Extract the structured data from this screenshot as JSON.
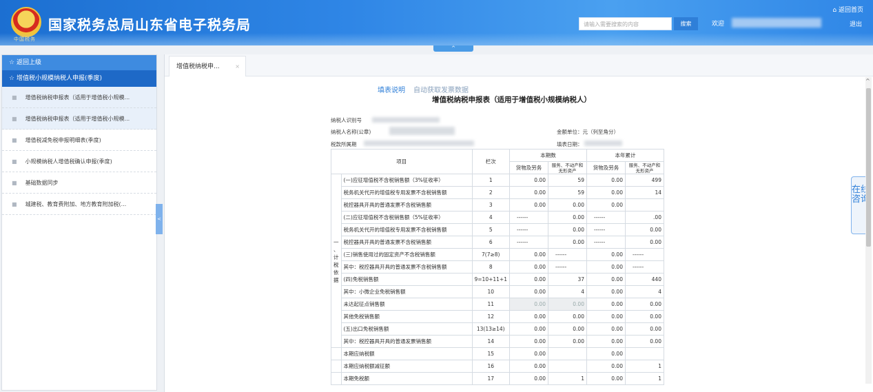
{
  "header": {
    "title": "国家税务总局山东省电子税务局",
    "emblem_text": "中国税务",
    "search_placeholder": "请输入需要搜索的内容",
    "search_button": "搜索",
    "welcome": "欢迎",
    "home": "返回首页",
    "logout": "退出",
    "collapse": "^"
  },
  "sidebar": {
    "back": "返回上级",
    "group": "增值税小规模纳税人申报(季度)",
    "items": [
      {
        "label": "增值税纳税申报表（适用于增值税小规模..."
      },
      {
        "label": "增值税纳税申报表（适用于增值税小规模..."
      },
      {
        "label": "增值税减免税申报明细表(季度)"
      },
      {
        "label": "小规模纳税人增值税确认申报(季度)"
      },
      {
        "label": "基础数据同步"
      },
      {
        "label": "城建税、教育费附加、地方教育附加税(..."
      }
    ],
    "toggle": "<"
  },
  "tabs": [
    {
      "label": "增值税纳税申...",
      "close": "×"
    }
  ],
  "report": {
    "link_fill": "填表说明",
    "link_auto": "自动获取发票数据",
    "title": "增值税纳税申报表（适用于增值税小规模纳税人）",
    "taxpayer_id_label": "纳税人识别号",
    "taxpayer_name_label": "纳税人名称(公章)",
    "period_label": "税款所属期",
    "unit_label": "金额单位：元（列至角分）",
    "fill_date_label": "填表日期：",
    "col_item": "项目",
    "col_line": "栏次",
    "col_current": "本期数",
    "col_ytd": "本年累计",
    "col_goods": "货物及劳务",
    "col_services": "服务、不动产和无形资产",
    "side_label": "一、计税依据",
    "rows": [
      {
        "item": "(一)应征增值税不含税销售额（3%征收率）",
        "line": "1",
        "c1": "0.00",
        "c2": "59",
        "c3": "0.00",
        "c4": "499"
      },
      {
        "item": "税务机关代开的增值税专用发票不含税销售额",
        "line": "2",
        "c1": "0.00",
        "c2": "59",
        "c3": "0.00",
        "c4": "14"
      },
      {
        "item": "税控器具开具的普通发票不含税销售额",
        "line": "3",
        "c1": "0.00",
        "c2": "0.00",
        "c3": "0.00",
        "c4": ""
      },
      {
        "item": "(二)应征增值税不含税销售额（5%征收率）",
        "line": "4",
        "c1": "------",
        "c2": "0.00",
        "c3": "------",
        "c4": ".00"
      },
      {
        "item": "税务机关代开的增值税专用发票不含税销售额",
        "line": "5",
        "c1": "------",
        "c2": "0.00",
        "c3": "------",
        "c4": "0.00"
      },
      {
        "item": "税控器具开具的普通发票不含税销售额",
        "line": "6",
        "c1": "------",
        "c2": "0.00",
        "c3": "------",
        "c4": "0.00"
      },
      {
        "item": "(三)销售使用过的固定资产不含税销售额",
        "line": "7(7≥8)",
        "c1": "0.00",
        "c2": "------",
        "c3": "0.00",
        "c4": "------"
      },
      {
        "item": "其中：税控器具开具的普通发票不含税销售额",
        "line": "8",
        "c1": "0.00",
        "c2": "------",
        "c3": "0.00",
        "c4": "------"
      },
      {
        "item": "(四)免税销售额",
        "line": "9=10+11+1",
        "c1": "0.00",
        "c2": "37",
        "c3": "0.00",
        "c4": "440"
      },
      {
        "item": "其中：小微企业免税销售额",
        "line": "10",
        "c1": "0.00",
        "c2": "4",
        "c3": "0.00",
        "c4": "4"
      },
      {
        "item": "未达起征点销售额",
        "line": "11",
        "c1": "0.00",
        "c2": "0.00",
        "c3": "0.00",
        "c4": "0.00"
      },
      {
        "item": "其他免税销售额",
        "line": "12",
        "c1": "0.00",
        "c2": "0.00",
        "c3": "0.00",
        "c4": "0.00"
      },
      {
        "item": "(五)出口免税销售额",
        "line": "13(13≥14)",
        "c1": "0.00",
        "c2": "0.00",
        "c3": "0.00",
        "c4": "0.00"
      },
      {
        "item": "其中：税控器具开具的普通发票销售额",
        "line": "14",
        "c1": "0.00",
        "c2": "0.00",
        "c3": "0.00",
        "c4": "0.00"
      },
      {
        "item": "本期应纳税额",
        "line": "15",
        "c1": "0.00",
        "c2": "",
        "c3": "0.00",
        "c4": ""
      },
      {
        "item": "本期应纳税额减征额",
        "line": "16",
        "c1": "0.00",
        "c2": "",
        "c3": "0.00",
        "c4": "1"
      },
      {
        "item": "本期免税额",
        "line": "17",
        "c1": "0.00",
        "c2": "1",
        "c3": "0.00",
        "c4": "1"
      }
    ]
  },
  "consult": "在线咨询",
  "colors": {
    "header": "#2f86e6",
    "sidebar_group": "#1e69c7",
    "link": "#2f7fd8"
  }
}
